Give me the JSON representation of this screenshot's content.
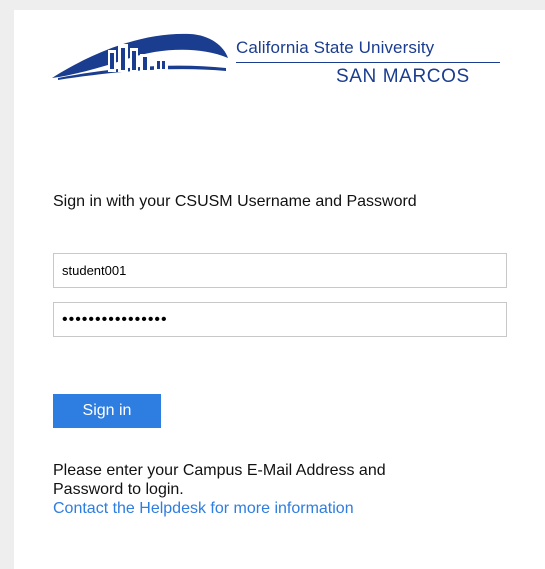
{
  "logo": {
    "line1": "California State University",
    "line2": "SAN MARCOS",
    "mark_icon": "csusm-campus-building-logo-icon"
  },
  "form": {
    "heading": "Sign in with your CSUSM Username and Password",
    "username_value": "student001",
    "password_value": "••••••••••••••••",
    "signin_label": "Sign in"
  },
  "info": {
    "line1": "Please enter your Campus E-Mail Address and",
    "line2": "Password to login.",
    "helpdesk_link": "Contact the Helpdesk for more information"
  },
  "colors": {
    "brand_navy": "#1b3d8f",
    "accent_blue": "#2e7de1",
    "page_background": "#eeeeee"
  }
}
